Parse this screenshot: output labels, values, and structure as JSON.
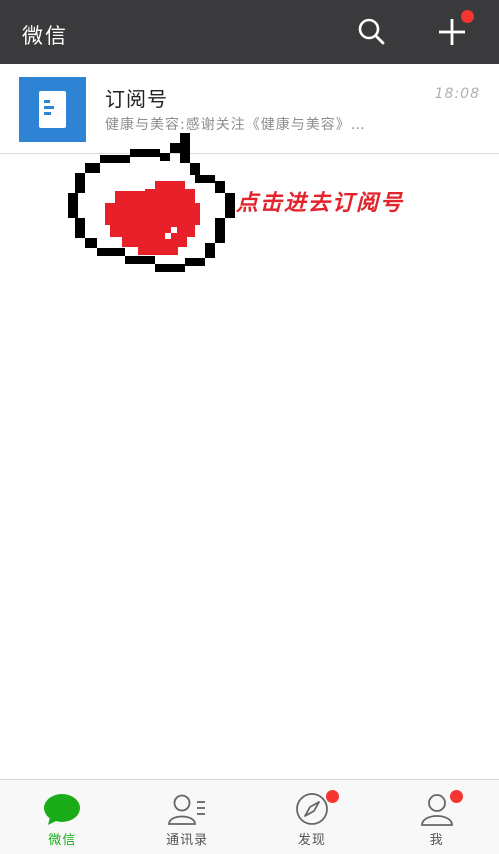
{
  "header": {
    "title": "微信",
    "search_icon": "search-icon",
    "add_icon": "plus-icon",
    "add_badge": true
  },
  "chat_list": [
    {
      "title": "订阅号",
      "preview": "健康与美容:感谢关注《健康与美容》…",
      "time": "18:08",
      "icon": "document-icon"
    }
  ],
  "annotation": {
    "text": "点击进去订阅号",
    "icon": "heart-speech-bubble-icon"
  },
  "tabbar": {
    "tabs": [
      {
        "label": "微信",
        "icon": "chat-bubble-icon",
        "active": true,
        "badge": false
      },
      {
        "label": "通讯录",
        "icon": "contacts-icon",
        "active": false,
        "badge": false
      },
      {
        "label": "发现",
        "icon": "compass-icon",
        "active": false,
        "badge": true
      },
      {
        "label": "我",
        "icon": "person-icon",
        "active": false,
        "badge": true
      }
    ]
  },
  "colors": {
    "topbar": "#3a3a3c",
    "badge": "#f43530",
    "active_tab": "#1aad19",
    "subscription_icon": "#2f83d5",
    "annotation": "#e4242c"
  }
}
